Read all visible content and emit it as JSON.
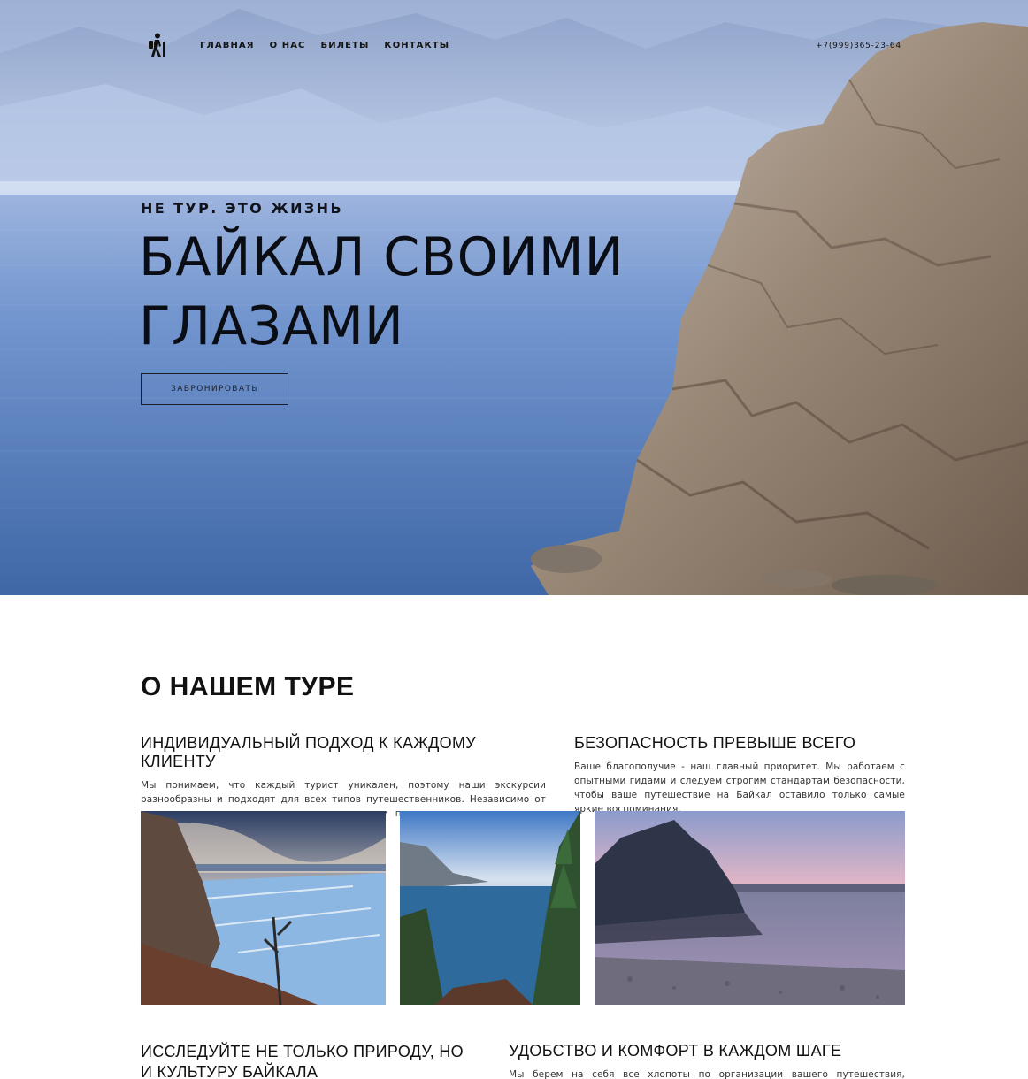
{
  "nav": {
    "logo_icon": "hiker-icon",
    "items": [
      {
        "label": "ГЛАВНАЯ"
      },
      {
        "label": "О НАС"
      },
      {
        "label": "БИЛЕТЫ"
      },
      {
        "label": "КОНТАКТЫ"
      }
    ],
    "phone": "+7(999)365-23-64"
  },
  "hero": {
    "tagline": "НЕ ТУР. ЭТО ЖИЗНЬ",
    "headline_line1": "БАЙКАЛ СВОИМИ",
    "headline_line2": "ГЛАЗАМИ",
    "cta_label": "ЗАБРОНИРОВАТЬ"
  },
  "about": {
    "title": "О НАШЕМ ТУРЕ",
    "features": [
      {
        "title": "ИНДИВИДУАЛЬНЫЙ ПОДХОД К КАЖДОМУ КЛИЕНТУ",
        "text": "Мы понимаем, что каждый турист уникален, поэтому наши экскурсии разнообразны и подходят для всех типов путешественников. Независимо от того, ищете ли вы приключение, релакс или погружение в культуру, мы найдем идеальный маршрут для вас."
      },
      {
        "title": "БЕЗОПАСНОСТЬ ПРЕВЫШЕ ВСЕГО",
        "text": "Ваше благополучие - наш главный приоритет. Мы работаем с опытными гидами и следуем строгим стандартам безопасности, чтобы ваше путешествие на Байкал оставило только самые яркие воспоминания."
      },
      {
        "title": "ИССЛЕДУЙТЕ НЕ ТОЛЬКО ПРИРОДУ, НО И КУЛЬТУРУ БАЙКАЛА",
        "text": ""
      },
      {
        "title": "УДОБСТВО И КОМФОРТ В КАЖДОМ ШАГЕ",
        "text": "Мы берем на себя все хлопоты по организации вашего путешествия, позволяя вам"
      }
    ]
  },
  "colors": {
    "sky": "#a9bde0",
    "water": "#4e77b6",
    "rock": "#9b8a78",
    "text": "#111111"
  }
}
